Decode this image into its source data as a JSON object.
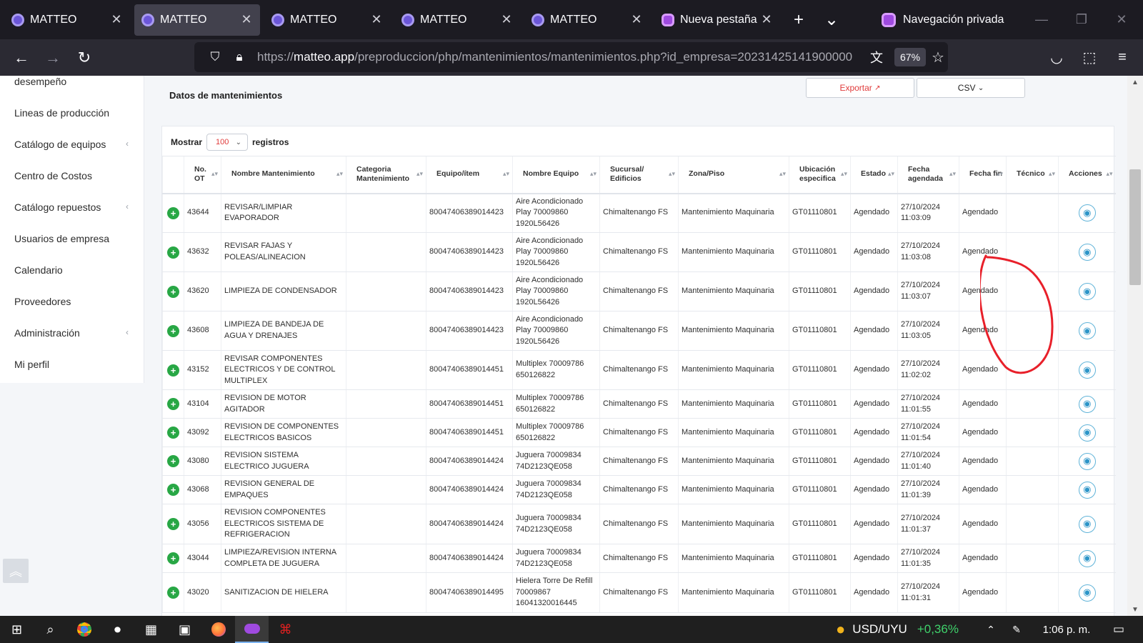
{
  "browser": {
    "tabs": [
      {
        "title": "MATTEO",
        "active": false
      },
      {
        "title": "MATTEO",
        "active": true
      },
      {
        "title": "MATTEO",
        "active": false
      },
      {
        "title": "MATTEO",
        "active": false
      },
      {
        "title": "MATTEO",
        "active": false
      },
      {
        "title": "Nueva pestaña p",
        "active": false
      }
    ],
    "private_label": "Navegación privada",
    "url_prefix": "https://",
    "url_host": "matteo.app",
    "url_path": "/preproduccion/php/mantenimientos/mantenimientos.php?id_empresa=20231425141900000",
    "zoom": "67%"
  },
  "sidebar": {
    "items": [
      {
        "label": "desempeño",
        "chevron": ""
      },
      {
        "label": "Lineas de producción",
        "chevron": ""
      },
      {
        "label": "Catálogo de equipos",
        "chevron": "‹"
      },
      {
        "label": "Centro de Costos",
        "chevron": ""
      },
      {
        "label": "Catálogo repuestos",
        "chevron": "‹"
      },
      {
        "label": "Usuarios de empresa",
        "chevron": ""
      },
      {
        "label": "Calendario",
        "chevron": ""
      },
      {
        "label": "Proveedores",
        "chevron": ""
      },
      {
        "label": "Administración",
        "chevron": "‹"
      },
      {
        "label": "Mi perfil",
        "chevron": ""
      }
    ]
  },
  "main": {
    "title": "Datos de mantenimientos",
    "export_label": "Exportar",
    "csv_label": "CSV",
    "show_label": "Mostrar",
    "show_value": "100",
    "records_label": "registros"
  },
  "table": {
    "headers": [
      "",
      "No. OT",
      "Nombre Mantenimiento",
      "Categoria Mantenimiento",
      "Equipo/ítem",
      "Nombre Equipo",
      "Sucursal/ Edificios",
      "Zona/Piso",
      "Ubicación especifica",
      "Estado",
      "Fecha agendada",
      "Fecha fin",
      "Técnico",
      "Acciones"
    ],
    "rows": [
      {
        "ot": "43644",
        "name": "REVISAR/LIMPIAR EVAPORADOR",
        "cat": "",
        "item": "80047406389014423",
        "equipo": "Aire Acondicionado Play 70009860 1920L56426",
        "sucursal": "Chimaltenango FS",
        "zona": "Mantenimiento Maquinaria",
        "ubic": "GT01110801",
        "estado": "Agendado",
        "fecha": "27/10/2024 11:03:09",
        "fin": "Agendado",
        "tecnico": ""
      },
      {
        "ot": "43632",
        "name": "REVISAR FAJAS Y POLEAS/ALINEACION",
        "cat": "",
        "item": "80047406389014423",
        "equipo": "Aire Acondicionado Play 70009860 1920L56426",
        "sucursal": "Chimaltenango FS",
        "zona": "Mantenimiento Maquinaria",
        "ubic": "GT01110801",
        "estado": "Agendado",
        "fecha": "27/10/2024 11:03:08",
        "fin": "Agendado",
        "tecnico": ""
      },
      {
        "ot": "43620",
        "name": "LIMPIEZA DE CONDENSADOR",
        "cat": "",
        "item": "80047406389014423",
        "equipo": "Aire Acondicionado Play 70009860 1920L56426",
        "sucursal": "Chimaltenango FS",
        "zona": "Mantenimiento Maquinaria",
        "ubic": "GT01110801",
        "estado": "Agendado",
        "fecha": "27/10/2024 11:03:07",
        "fin": "Agendado",
        "tecnico": ""
      },
      {
        "ot": "43608",
        "name": "LIMPIEZA DE BANDEJA DE AGUA Y DRENAJES",
        "cat": "",
        "item": "80047406389014423",
        "equipo": "Aire Acondicionado Play 70009860 1920L56426",
        "sucursal": "Chimaltenango FS",
        "zona": "Mantenimiento Maquinaria",
        "ubic": "GT01110801",
        "estado": "Agendado",
        "fecha": "27/10/2024 11:03:05",
        "fin": "Agendado",
        "tecnico": ""
      },
      {
        "ot": "43152",
        "name": "REVISAR COMPONENTES ELECTRICOS Y DE CONTROL MULTIPLEX",
        "cat": "",
        "item": "80047406389014451",
        "equipo": "Multiplex 70009786 650126822",
        "sucursal": "Chimaltenango FS",
        "zona": "Mantenimiento Maquinaria",
        "ubic": "GT01110801",
        "estado": "Agendado",
        "fecha": "27/10/2024 11:02:02",
        "fin": "Agendado",
        "tecnico": ""
      },
      {
        "ot": "43104",
        "name": "REVISION DE MOTOR AGITADOR",
        "cat": "",
        "item": "80047406389014451",
        "equipo": "Multiplex 70009786 650126822",
        "sucursal": "Chimaltenango FS",
        "zona": "Mantenimiento Maquinaria",
        "ubic": "GT01110801",
        "estado": "Agendado",
        "fecha": "27/10/2024 11:01:55",
        "fin": "Agendado",
        "tecnico": ""
      },
      {
        "ot": "43092",
        "name": "REVISION DE COMPONENTES ELECTRICOS BASICOS",
        "cat": "",
        "item": "80047406389014451",
        "equipo": "Multiplex 70009786 650126822",
        "sucursal": "Chimaltenango FS",
        "zona": "Mantenimiento Maquinaria",
        "ubic": "GT01110801",
        "estado": "Agendado",
        "fecha": "27/10/2024 11:01:54",
        "fin": "Agendado",
        "tecnico": ""
      },
      {
        "ot": "43080",
        "name": "REVISION SISTEMA ELECTRICO JUGUERA",
        "cat": "",
        "item": "80047406389014424",
        "equipo": "Juguera 70009834 74D2123QE058",
        "sucursal": "Chimaltenango FS",
        "zona": "Mantenimiento Maquinaria",
        "ubic": "GT01110801",
        "estado": "Agendado",
        "fecha": "27/10/2024 11:01:40",
        "fin": "Agendado",
        "tecnico": ""
      },
      {
        "ot": "43068",
        "name": "REVISION GENERAL DE EMPAQUES",
        "cat": "",
        "item": "80047406389014424",
        "equipo": "Juguera 70009834 74D2123QE058",
        "sucursal": "Chimaltenango FS",
        "zona": "Mantenimiento Maquinaria",
        "ubic": "GT01110801",
        "estado": "Agendado",
        "fecha": "27/10/2024 11:01:39",
        "fin": "Agendado",
        "tecnico": ""
      },
      {
        "ot": "43056",
        "name": "REVISION COMPONENTES ELECTRICOS SISTEMA DE REFRIGERACION",
        "cat": "",
        "item": "80047406389014424",
        "equipo": "Juguera 70009834 74D2123QE058",
        "sucursal": "Chimaltenango FS",
        "zona": "Mantenimiento Maquinaria",
        "ubic": "GT01110801",
        "estado": "Agendado",
        "fecha": "27/10/2024 11:01:37",
        "fin": "Agendado",
        "tecnico": ""
      },
      {
        "ot": "43044",
        "name": "LIMPIEZA/REVISION INTERNA COMPLETA DE JUGUERA",
        "cat": "",
        "item": "80047406389014424",
        "equipo": "Juguera 70009834 74D2123QE058",
        "sucursal": "Chimaltenango FS",
        "zona": "Mantenimiento Maquinaria",
        "ubic": "GT01110801",
        "estado": "Agendado",
        "fecha": "27/10/2024 11:01:35",
        "fin": "Agendado",
        "tecnico": ""
      },
      {
        "ot": "43020",
        "name": "SANITIZACION DE HIELERA",
        "cat": "",
        "item": "80047406389014495",
        "equipo": "Hielera Torre De Refill 70009867 16041320016445",
        "sucursal": "Chimaltenango FS",
        "zona": "Mantenimiento Maquinaria",
        "ubic": "GT01110801",
        "estado": "Agendado",
        "fecha": "27/10/2024 11:01:31",
        "fin": "Agendado",
        "tecnico": ""
      }
    ]
  },
  "taskbar": {
    "ticker_symbol": "USD/UYU",
    "ticker_change": "+0,36%",
    "time": "1:06 p. m."
  },
  "colors": {
    "accent_red": "#e03b3b",
    "plus_green": "#28a745",
    "eye_blue": "#2d95c8",
    "annotation_red": "#e8202a"
  }
}
